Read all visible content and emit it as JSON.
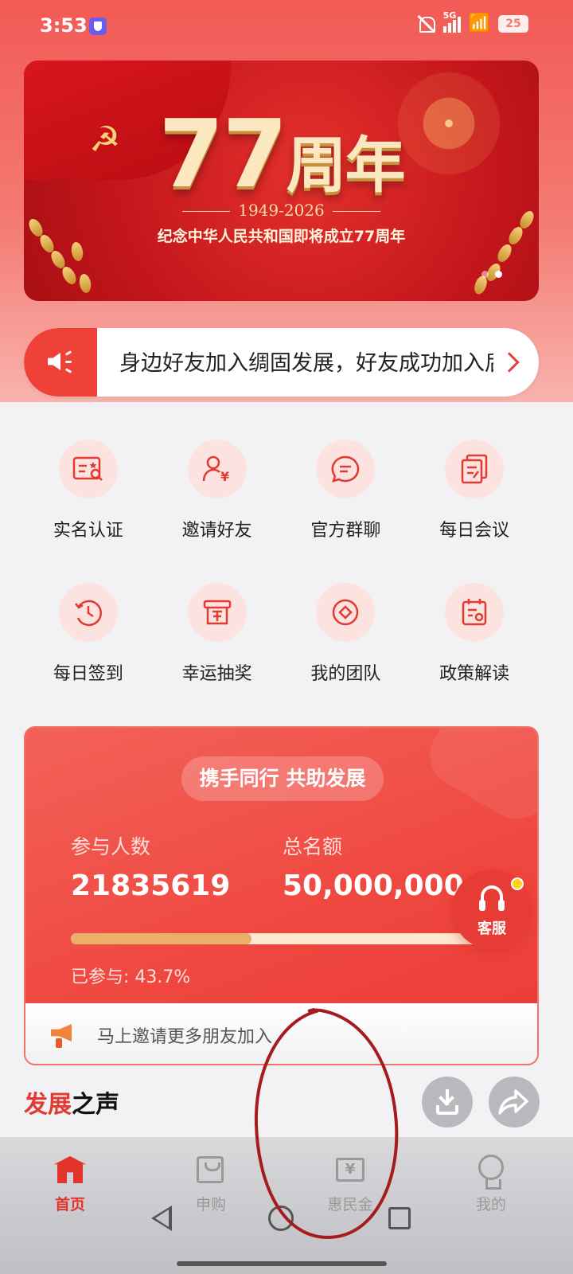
{
  "status_bar": {
    "time": "3:53",
    "network": "5G",
    "wifi_tag": "6",
    "battery": "25"
  },
  "banner": {
    "title_number": "77",
    "title_suffix": "周年",
    "years": "1949-2026",
    "subtitle": "纪念中华人民共和国即将成立77周年",
    "page_count": 2,
    "active_page": 2
  },
  "notice": {
    "text": "身边好友加入绸固发展，好友成功加入后"
  },
  "grid": {
    "items": [
      {
        "label": "实名认证",
        "icon": "id-card-icon"
      },
      {
        "label": "邀请好友",
        "icon": "invite-user-icon"
      },
      {
        "label": "官方群聊",
        "icon": "chat-bubble-icon"
      },
      {
        "label": "每日会议",
        "icon": "documents-icon"
      },
      {
        "label": "每日签到",
        "icon": "clock-checkin-icon"
      },
      {
        "label": "幸运抽奖",
        "icon": "lottery-box-icon"
      },
      {
        "label": "我的团队",
        "icon": "team-diamond-icon"
      },
      {
        "label": "政策解读",
        "icon": "policy-calendar-icon"
      }
    ]
  },
  "stats": {
    "headline": "携手同行 共助发展",
    "participants_label": "参与人数",
    "participants_value": "21835619",
    "total_label": "总名额",
    "total_value": "50,000,000",
    "progress_fraction": 0.437,
    "progress_text": "已参与: 43.7%",
    "invite_text": "马上邀请更多朋友加入"
  },
  "service": {
    "label": "客服"
  },
  "voice": {
    "title_accent": "发展",
    "title_rest": "之声"
  },
  "bottom_nav": {
    "items": [
      {
        "label": "首页",
        "active": true
      },
      {
        "label": "申购",
        "active": false
      },
      {
        "label": "惠民金",
        "active": false
      },
      {
        "label": "我的",
        "active": false
      }
    ]
  },
  "colors": {
    "primary_red": "#e3332b",
    "icon_bg": "#fde3e0",
    "progress_fill": "#e9b06a",
    "annotation_circle": "#a61c1c"
  }
}
